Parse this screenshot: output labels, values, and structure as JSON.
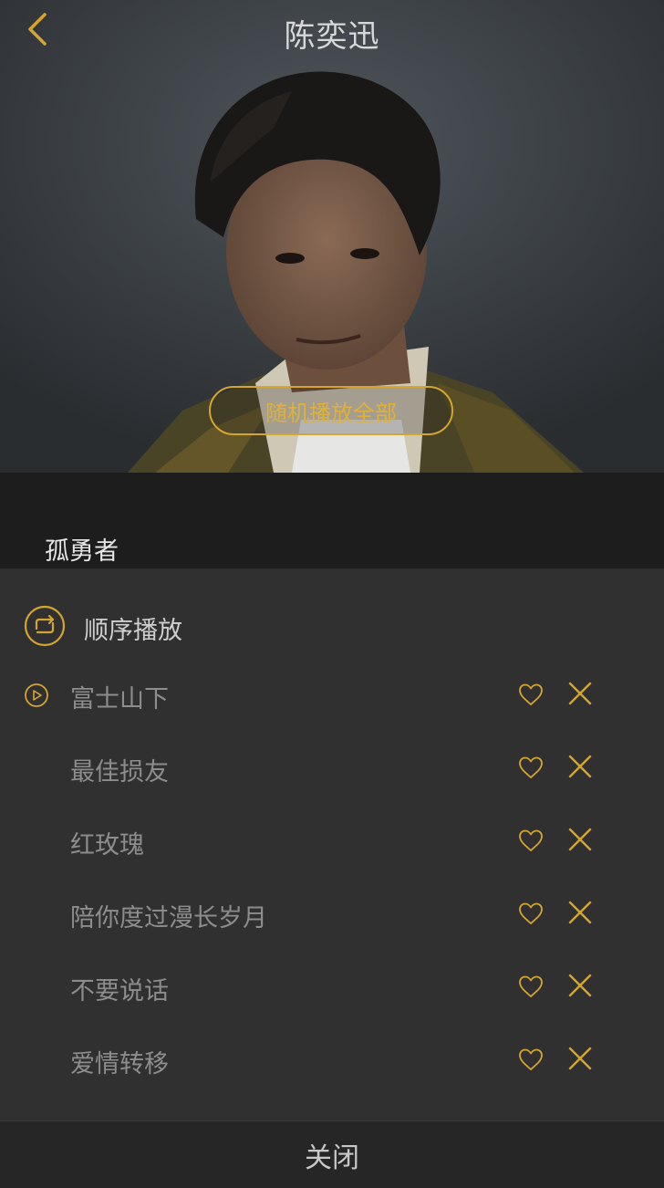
{
  "header": {
    "title": "陈奕迅",
    "back_icon": "chevron-left-icon"
  },
  "hero": {
    "shuffle_all_label": "随机播放全部"
  },
  "background_list": {
    "current_song": "孤勇者"
  },
  "sheet": {
    "play_mode_icon": "repeat-order-icon",
    "play_mode_label": "顺序播放",
    "songs": [
      {
        "title": "富士山下",
        "playing": true
      },
      {
        "title": "最佳损友",
        "playing": false
      },
      {
        "title": "红玫瑰",
        "playing": false
      },
      {
        "title": "陪你度过漫长岁月",
        "playing": false
      },
      {
        "title": "不要说话",
        "playing": false
      },
      {
        "title": "爱情转移",
        "playing": false
      }
    ]
  },
  "footer": {
    "close_label": "关闭"
  },
  "colors": {
    "accent": "#d4a52f",
    "sheet_bg": "#303030",
    "text_muted": "#8d8d8d"
  }
}
